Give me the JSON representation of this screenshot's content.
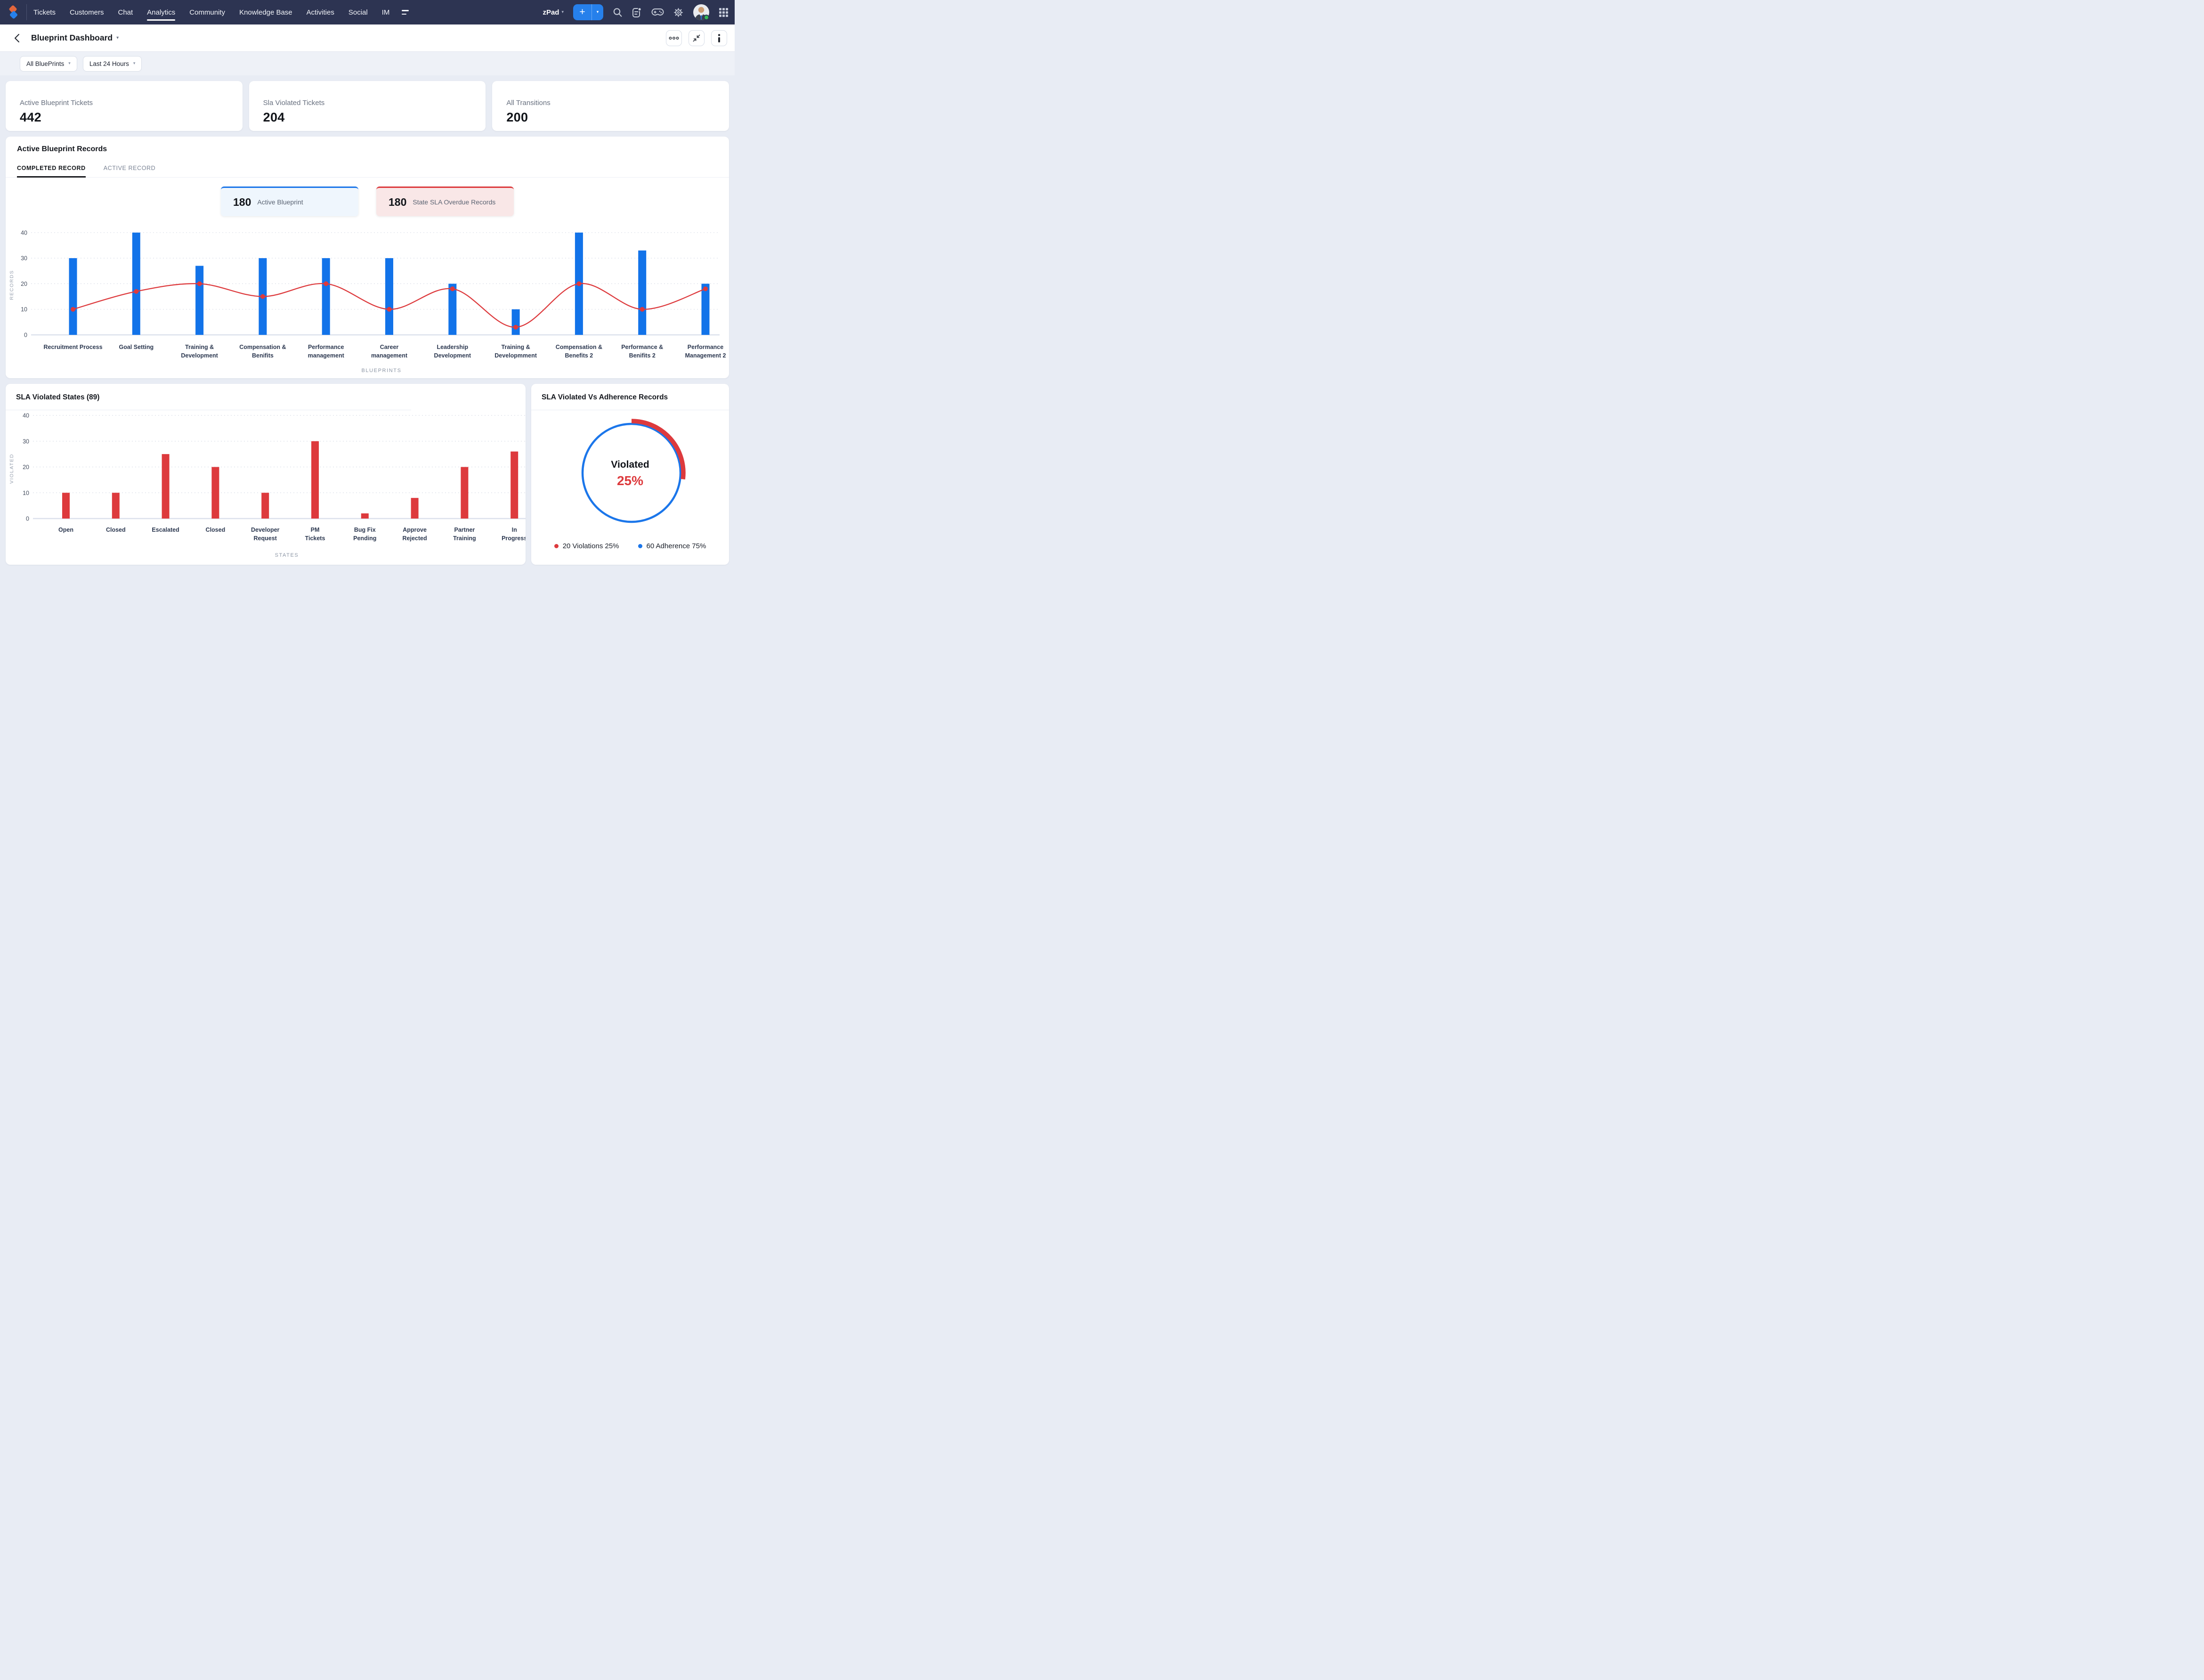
{
  "navbar": {
    "items": [
      "Tickets",
      "Customers",
      "Chat",
      "Analytics",
      "Community",
      "Knowledge Base",
      "Activities",
      "Social",
      "IM"
    ],
    "active_item": "Analytics",
    "workspace_label": "zPad",
    "icons": [
      "plus-icon",
      "caret-down-icon",
      "search-icon",
      "feed-icon",
      "gamepad-icon",
      "gear-icon",
      "avatar",
      "apps-grid-icon"
    ],
    "avatar_status": "online"
  },
  "header": {
    "title": "Blueprint Dashboard",
    "actions": [
      "more-options",
      "collapse",
      "info"
    ]
  },
  "filters": {
    "blueprint_filter": "All BluePrints",
    "time_filter": "Last 24 Hours"
  },
  "stat_cards": [
    {
      "label": "Active Blueprint Tickets",
      "value": "442"
    },
    {
      "label": "Sla Violated Tickets",
      "value": "204"
    },
    {
      "label": "All Transitions",
      "value": "200"
    }
  ],
  "blueprint_panel": {
    "title": "Active Blueprint Records",
    "tabs": [
      {
        "label": "COMPLETED RECORD",
        "active": true
      },
      {
        "label": "ACTIVE RECORD",
        "active": false
      }
    ],
    "badges": [
      {
        "value": "180",
        "label": "Active Blueprint",
        "accent": "#1b76ea"
      },
      {
        "value": "180",
        "label": "State SLA Overdue Records",
        "accent": "#dd3a3d"
      }
    ],
    "chart_data": {
      "type": "bar+line",
      "categories": [
        [
          "Recruitment Process"
        ],
        [
          "Goal Setting"
        ],
        [
          "Training &",
          "Development"
        ],
        [
          "Compensation &",
          "Benifits"
        ],
        [
          "Performance",
          "management"
        ],
        [
          "Career",
          "management"
        ],
        [
          "Leadership",
          "Development"
        ],
        [
          "Training &",
          "Developmment"
        ],
        [
          "Compensation &",
          "Benefits 2"
        ],
        [
          "Performance &",
          "Benifits 2"
        ],
        [
          "Performance",
          "Management 2"
        ]
      ],
      "series": [
        {
          "name": "records",
          "type": "bar",
          "color": "#1273e9",
          "values": [
            30,
            40,
            27,
            30,
            30,
            30,
            20,
            10,
            40,
            33,
            20
          ]
        },
        {
          "name": "overdue",
          "type": "line",
          "color": "#dd3a3d",
          "values": [
            10,
            17,
            20,
            15,
            20,
            10,
            18,
            3,
            20,
            10,
            18
          ]
        }
      ],
      "ylabel": "RECORDS",
      "xlabel": "BLUEPRINTS",
      "ylim": [
        0,
        40
      ],
      "yticks": [
        0,
        10,
        20,
        30,
        40
      ],
      "grid": "dotted-horizontal"
    }
  },
  "sla_states_panel": {
    "title": "SLA Violated States (89)",
    "chart_data": {
      "type": "bar",
      "categories": [
        [
          "Open"
        ],
        [
          "Closed"
        ],
        [
          "Escalated"
        ],
        [
          "Closed"
        ],
        [
          "Developer",
          "Request"
        ],
        [
          "PM",
          "Tickets"
        ],
        [
          "Bug Fix",
          "Pending"
        ],
        [
          "Approve",
          "Rejected"
        ],
        [
          "Partner",
          "Training"
        ],
        [
          "In",
          "Progress"
        ]
      ],
      "values": [
        10,
        10,
        25,
        20,
        10,
        30,
        2,
        8,
        20,
        26
      ],
      "color": "#dd3a3d",
      "ylabel": "VIOLATED",
      "xlabel": "STATES",
      "ylim": [
        0,
        40
      ],
      "yticks": [
        0,
        10,
        20,
        30,
        40
      ],
      "grid": "dotted-horizontal"
    }
  },
  "donut_panel": {
    "title": "SLA Violated Vs Adherence Records",
    "center_label": "Violated",
    "center_value": "25%",
    "chart_data": {
      "type": "pie",
      "slices": [
        {
          "label": "Violations",
          "count": 20,
          "percent": 25,
          "color": "#dd3a3d"
        },
        {
          "label": "Adherence",
          "count": 60,
          "percent": 75,
          "color": "#1b76ea"
        }
      ]
    },
    "legend": [
      {
        "text": "20 Violations 25%",
        "color": "#dd3a3d"
      },
      {
        "text": "60 Adherence 75%",
        "color": "#1b76ea"
      }
    ]
  },
  "colors": {
    "navbar_bg": "#2d3452",
    "page_bg": "#e8ecf4",
    "accent_blue": "#1b76ea",
    "accent_red": "#dd3a3d"
  }
}
